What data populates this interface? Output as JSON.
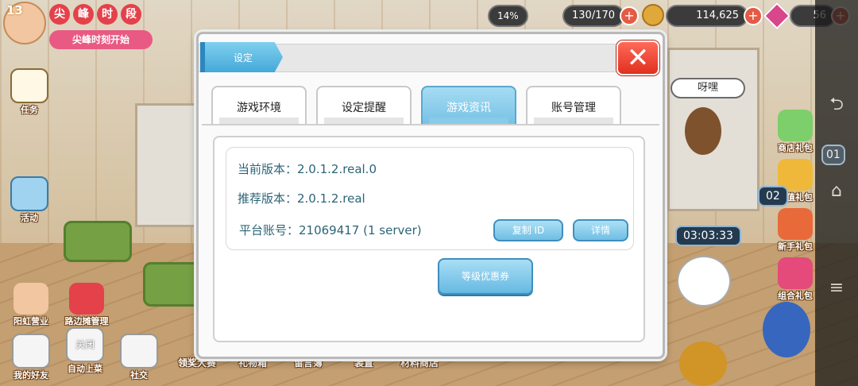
{
  "hud": {
    "level": "13",
    "event_chars": [
      "尖",
      "峰",
      "时",
      "段"
    ],
    "event_banner": "尖峰时刻开始",
    "percent": "14%",
    "energy": "130/170",
    "coins": "114,625",
    "gems": "56"
  },
  "left_sidebar": [
    {
      "label": "任务",
      "icon": "clipboard-icon"
    },
    {
      "label": "活动",
      "icon": "event-board-icon"
    }
  ],
  "bottom_left": [
    {
      "label": "阳虹营业",
      "icon": "girl-avatar-icon"
    },
    {
      "label": "路边摊管理",
      "icon": "stall-icon"
    },
    {
      "label": "我的好友",
      "icon": "friends-icon"
    },
    {
      "label": "关闭",
      "icon": "close-toggle-icon"
    },
    {
      "label": "自动上菜",
      "icon": "auto-serve-icon"
    },
    {
      "label": "社交",
      "icon": "chat-icon"
    }
  ],
  "bottom_bar": [
    "领奖大赛",
    "礼物箱",
    "留言簿",
    "装置",
    "材料商店"
  ],
  "right_sidebar": [
    {
      "label": "商店礼包",
      "icon": "gift-shop-icon"
    },
    {
      "label": "超值礼包",
      "icon": "value-pack-icon"
    },
    {
      "label": "新手礼包",
      "icon": "newbie-pack-icon"
    },
    {
      "label": "组合礼包",
      "icon": "combo-pack-icon"
    }
  ],
  "timers": {
    "side": "02",
    "main": "03:03:33",
    "corner": "01"
  },
  "npc_bubble": "呀嘿",
  "dialog": {
    "title": "设定",
    "close_symbol": "✕",
    "tabs": [
      "游戏环境",
      "设定提醒",
      "游戏资讯",
      "账号管理"
    ],
    "active_tab": 2,
    "info": {
      "current_version": "当前版本：2.0.1.2.real.0",
      "recommended_version": "推荐版本：2.0.1.2.real",
      "platform_account": "平台账号：21069417 (1 server)"
    },
    "copy_id_button": "复制 ID",
    "details_button": "详情",
    "coupon_button": "等级优惠券"
  },
  "system_nav": {
    "back": "⮌",
    "home": "⌂",
    "menu": "≡"
  },
  "colors": {
    "accent_blue": "#76c0e5",
    "close_red": "#e0301f",
    "info_text": "#2c6477"
  }
}
